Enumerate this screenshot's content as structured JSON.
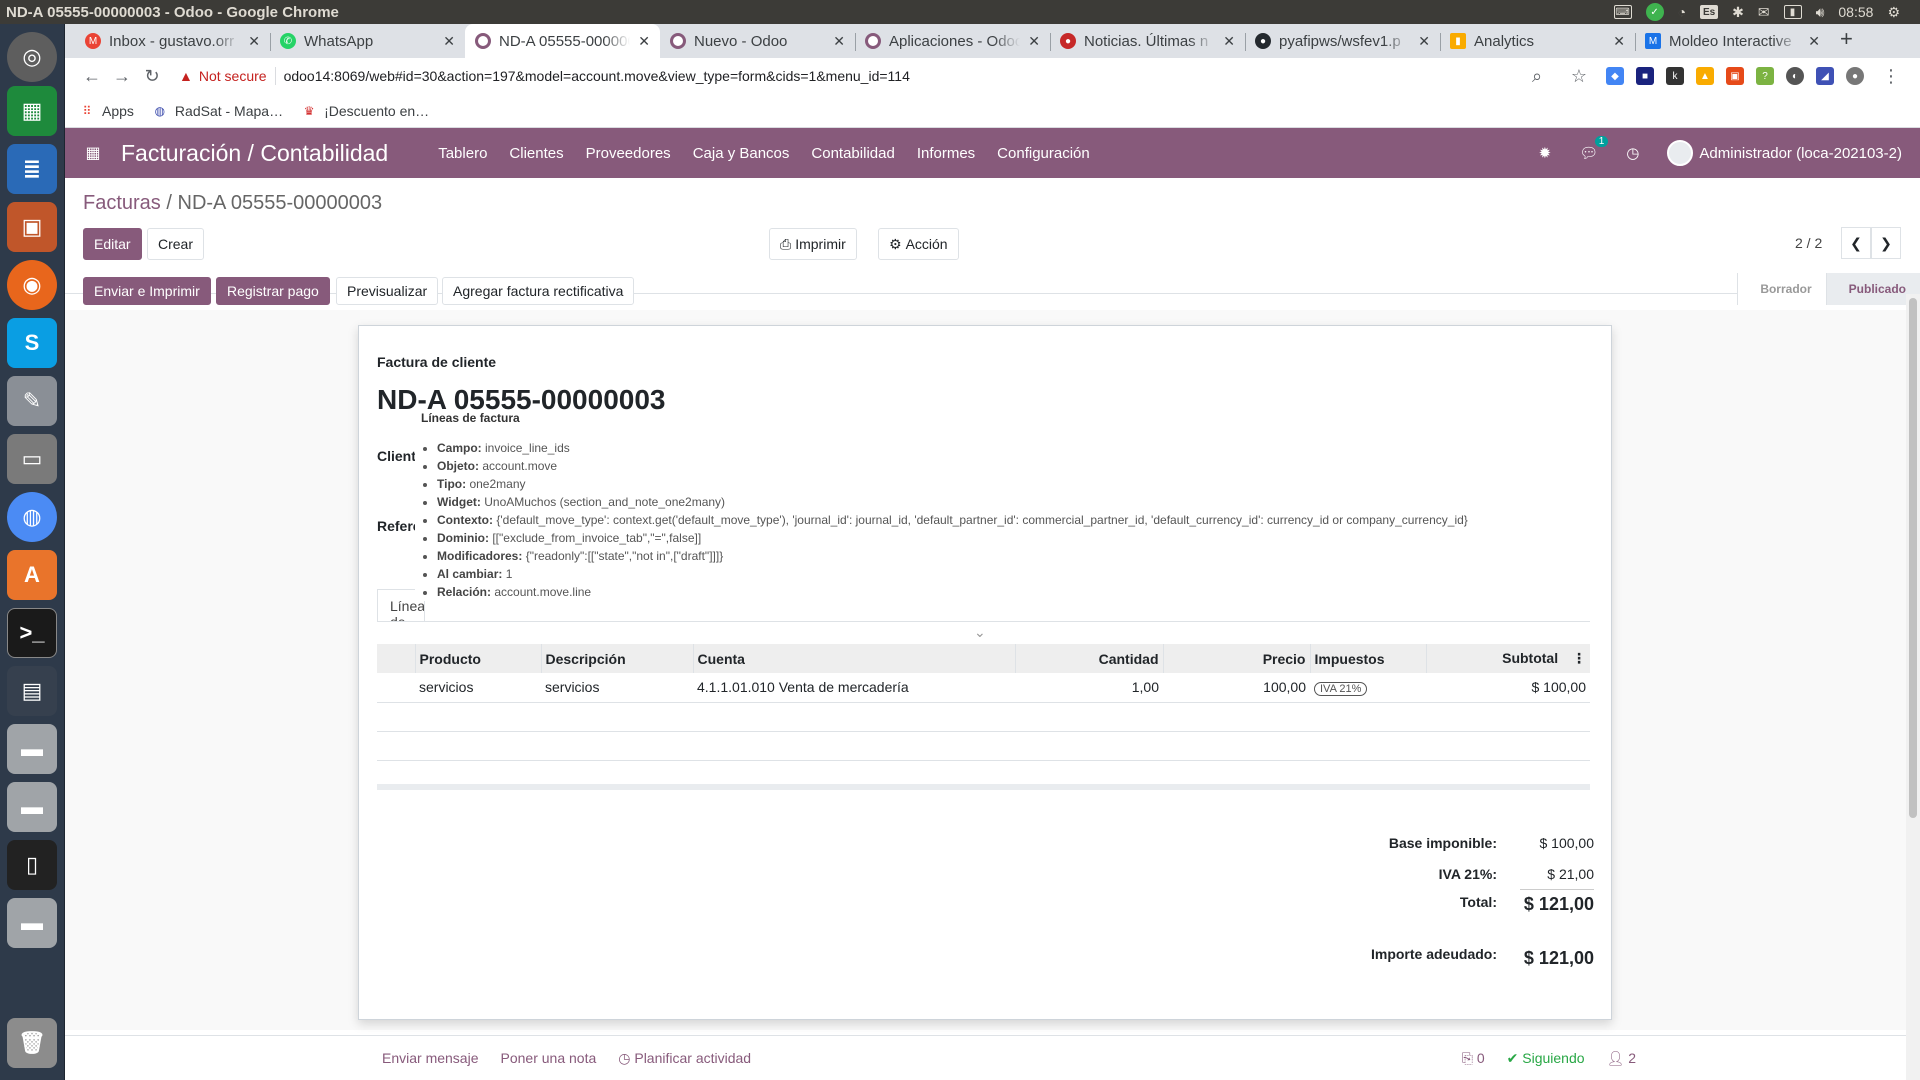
{
  "os": {
    "window_title": "ND-A 05555-00000003 - Odoo - Google Chrome",
    "lang": "Es",
    "time": "08:58"
  },
  "tabs": [
    {
      "label": "Inbox - gustavo.orr",
      "color": "#ea4335",
      "icon": "gmail-icon"
    },
    {
      "label": "WhatsApp",
      "color": "#25d366",
      "icon": "whatsapp-icon"
    },
    {
      "label": "ND-A 05555-00000003",
      "color": "#875a7b",
      "icon": "odoo-icon"
    },
    {
      "label": "Nuevo - Odoo",
      "color": "#875a7b",
      "icon": "odoo-icon"
    },
    {
      "label": "Aplicaciones - Odoo",
      "color": "#875a7b",
      "icon": "odoo-icon"
    },
    {
      "label": "Noticias. Últimas n",
      "color": "#c62828",
      "icon": "news-icon"
    },
    {
      "label": "pyafipws/wsfev1.p",
      "color": "#24292e",
      "icon": "github-icon"
    },
    {
      "label": "Analytics",
      "color": "#f9ab00",
      "icon": "analytics-icon"
    },
    {
      "label": "Moldeo Interactive",
      "color": "#1a73e8",
      "icon": "moldeo-icon"
    }
  ],
  "address": {
    "not_secure": "Not secure",
    "url": "odoo14:8069/web#id=30&action=197&model=account.move&view_type=form&cids=1&menu_id=114"
  },
  "bookmarks": [
    {
      "label": "Apps",
      "icon": "apps-grid-icon"
    },
    {
      "label": "RadSat - Mapa…",
      "icon": "globe-icon"
    },
    {
      "label": "¡Descuento en…",
      "icon": "promo-icon"
    }
  ],
  "odoo": {
    "app_name": "Facturación / Contabilidad",
    "menu": [
      "Tablero",
      "Clientes",
      "Proveedores",
      "Caja y Bancos",
      "Contabilidad",
      "Informes",
      "Configuración"
    ],
    "messages_count": "1",
    "user": "Administrador (loca-202103-2)"
  },
  "control": {
    "breadcrumb_parent": "Facturas",
    "breadcrumb_current": "ND-A 05555-00000003",
    "edit": "Editar",
    "create": "Crear",
    "print": "Imprimir",
    "action": "Acción",
    "pager": "2 / 2",
    "header_buttons": [
      "Enviar e Imprimir",
      "Registrar pago",
      "Previsualizar",
      "Agregar factura rectificativa"
    ],
    "statuses": [
      "Borrador",
      "Publicado"
    ],
    "active_status": "Publicado"
  },
  "form": {
    "type_label": "Factura de cliente",
    "name": "ND-A 05555-00000003",
    "label_customer": "Cliente",
    "label_reference": "Referen",
    "tab_label": "Líneas de factura"
  },
  "tooltip": {
    "title": "Líneas de factura",
    "items": [
      {
        "key": "Campo:",
        "value": "invoice_line_ids"
      },
      {
        "key": "Objeto:",
        "value": "account.move"
      },
      {
        "key": "Tipo:",
        "value": "one2many"
      },
      {
        "key": "Widget:",
        "value": "UnoAMuchos (section_and_note_one2many)"
      },
      {
        "key": "Contexto:",
        "value": "{'default_move_type': context.get('default_move_type'), 'journal_id': journal_id, 'default_partner_id': commercial_partner_id, 'default_currency_id': currency_id or company_currency_id}"
      },
      {
        "key": "Dominio:",
        "value": "[[\"exclude_from_invoice_tab\",\"=\",false]]"
      },
      {
        "key": "Modificadores:",
        "value": "{\"readonly\":[[\"state\",\"not in\",[\"draft\"]]]}"
      },
      {
        "key": "Al cambiar:",
        "value": "1"
      },
      {
        "key": "Relación:",
        "value": "account.move.line"
      }
    ]
  },
  "lines": {
    "headers": [
      "Producto",
      "Descripción",
      "Cuenta",
      "Cantidad",
      "Precio",
      "Impuestos",
      "Subtotal"
    ],
    "rows": [
      {
        "product": "servicios",
        "description": "servicios",
        "account": "4.1.1.01.010 Venta de mercadería",
        "quantity": "1,00",
        "price": "100,00",
        "tax": "IVA 21%",
        "subtotal": "$ 100,00"
      }
    ]
  },
  "totals": {
    "base_label": "Base imponible:",
    "base_value": "$ 100,00",
    "iva_label": "IVA 21%:",
    "iva_value": "$ 21,00",
    "total_label": "Total:",
    "total_value": "$ 121,00",
    "due_label": "Importe adeudado:",
    "due_value": "$ 121,00"
  },
  "chatter": {
    "send_message": "Enviar mensaje",
    "log_note": "Poner una nota",
    "schedule": "Planificar actividad",
    "attachments": "0",
    "following": "Siguiendo",
    "followers": "2"
  }
}
